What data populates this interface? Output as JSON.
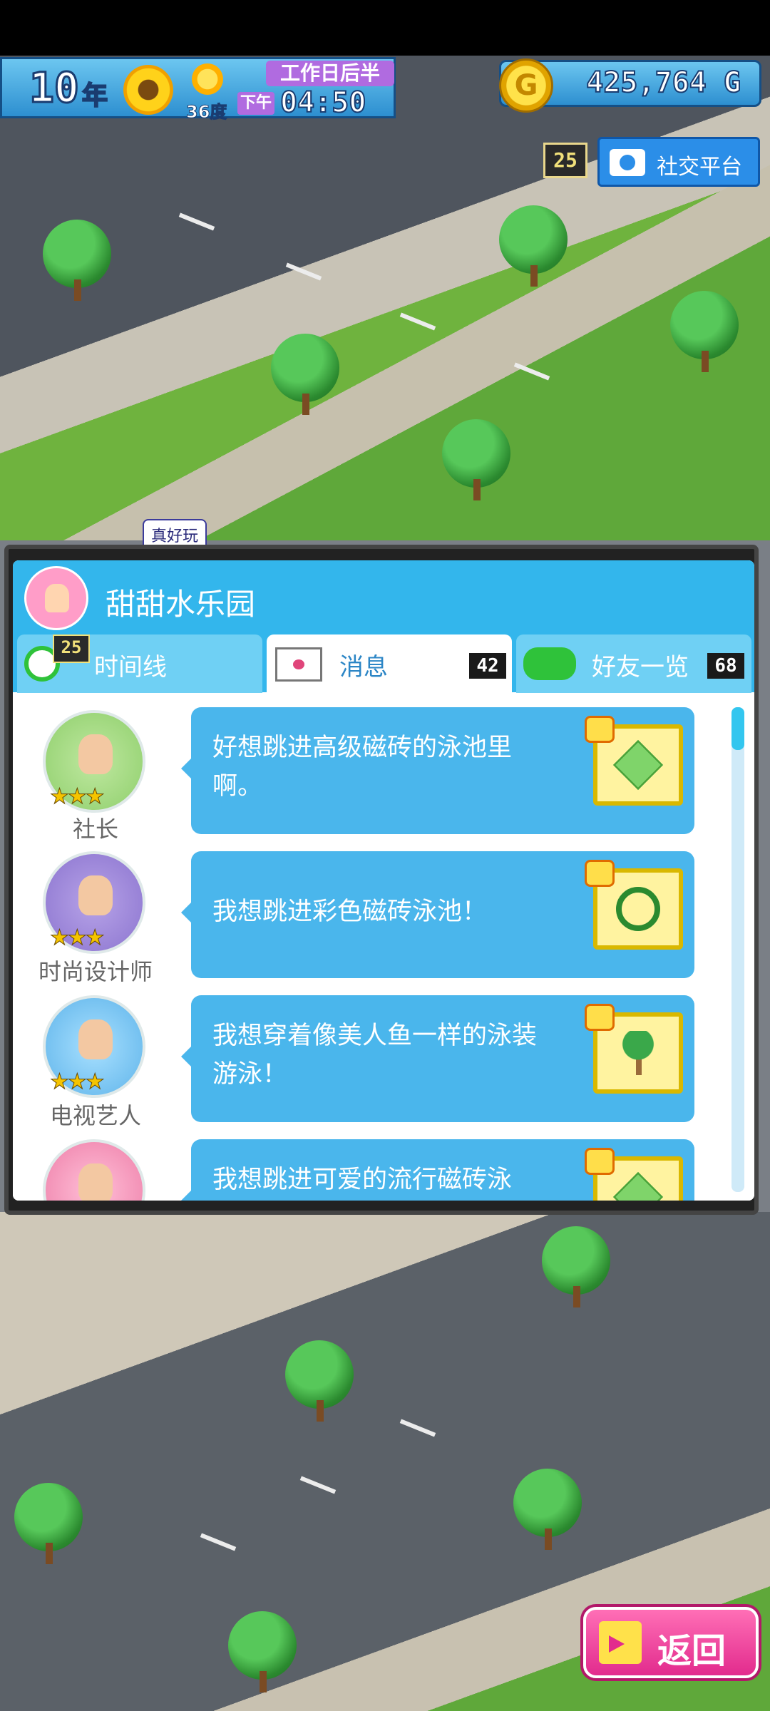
{
  "hud": {
    "year_number": "10",
    "year_unit": "年",
    "season_icon": "sunflower-icon",
    "weather_icon": "sun-icon",
    "temperature": "36度",
    "period": "工作日后半",
    "ampm": "下午",
    "time": "04:50",
    "money": "425,764 G",
    "coin_letter": "G"
  },
  "social": {
    "count": "25",
    "label": "社交平台",
    "icon": "camera-icon"
  },
  "scene": {
    "sign_text": "真好玩"
  },
  "panel": {
    "park_name": "甜甜水乐园",
    "tabs": [
      {
        "label": "时间线",
        "badge": "25",
        "icon": "clock-icon"
      },
      {
        "label": "消息",
        "count": "42",
        "icon": "mail-heart-icon"
      },
      {
        "label": "好友一览",
        "count": "68",
        "icon": "friends-icon"
      }
    ],
    "messages": [
      {
        "role": "社长",
        "stars": "★★★",
        "text": "好想跳进高级磁砖的泳池里啊。",
        "gift_icon": "tile-icon"
      },
      {
        "role": "时尚设计师",
        "stars": "★★★",
        "text": "我想跳进彩色磁砖泳池！",
        "gift_icon": "water-slide-icon"
      },
      {
        "role": "电视艺人",
        "stars": "★★★",
        "text": "我想穿着像美人鱼一样的泳装游泳！",
        "gift_icon": "palm-tree-icon"
      },
      {
        "role": "",
        "stars": "",
        "text": "我想跳进可爱的流行磁砖泳",
        "gift_icon": "tile-icon"
      }
    ]
  },
  "back_button": {
    "label": "返回",
    "icon": "back-arrow-icon"
  },
  "colors": {
    "panel_header": "#33b6ec",
    "bubble": "#4ab6ec",
    "back_button": "#e22b8d"
  }
}
